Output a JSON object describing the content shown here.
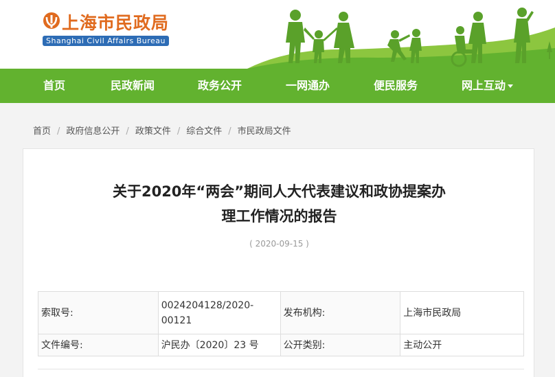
{
  "site": {
    "title": "上海市民政局",
    "subtitle": "Shanghai Civil Affairs Bureau"
  },
  "nav": {
    "items": [
      {
        "label": "首页"
      },
      {
        "label": "民政新闻"
      },
      {
        "label": "政务公开"
      },
      {
        "label": "一网通办"
      },
      {
        "label": "便民服务"
      },
      {
        "label": "网上互动"
      }
    ]
  },
  "breadcrumb": [
    "首页",
    "政府信息公开",
    "政策文件",
    "综合文件",
    "市民政局文件"
  ],
  "article": {
    "title_line1": "关于2020年“两会”期间人大代表建议和政协提案办",
    "title_line2": "理工作情况的报告",
    "date": "( 2020-09-15 )"
  },
  "meta": {
    "index_label": "索取号:",
    "index_value_line1": "0024204128/2020-",
    "index_value_line2": "00121",
    "publisher_label": "发布机构:",
    "publisher_value": "上海市民政局",
    "doc_no_label": "文件编号:",
    "doc_no_value": "沪民办〔2020〕23 号",
    "category_label": "公开类别:",
    "category_value": "主动公开"
  },
  "colors": {
    "nav_green": "#62b22f",
    "logo_orange": "#e06b1f",
    "logo_blue": "#2d6cb5"
  }
}
